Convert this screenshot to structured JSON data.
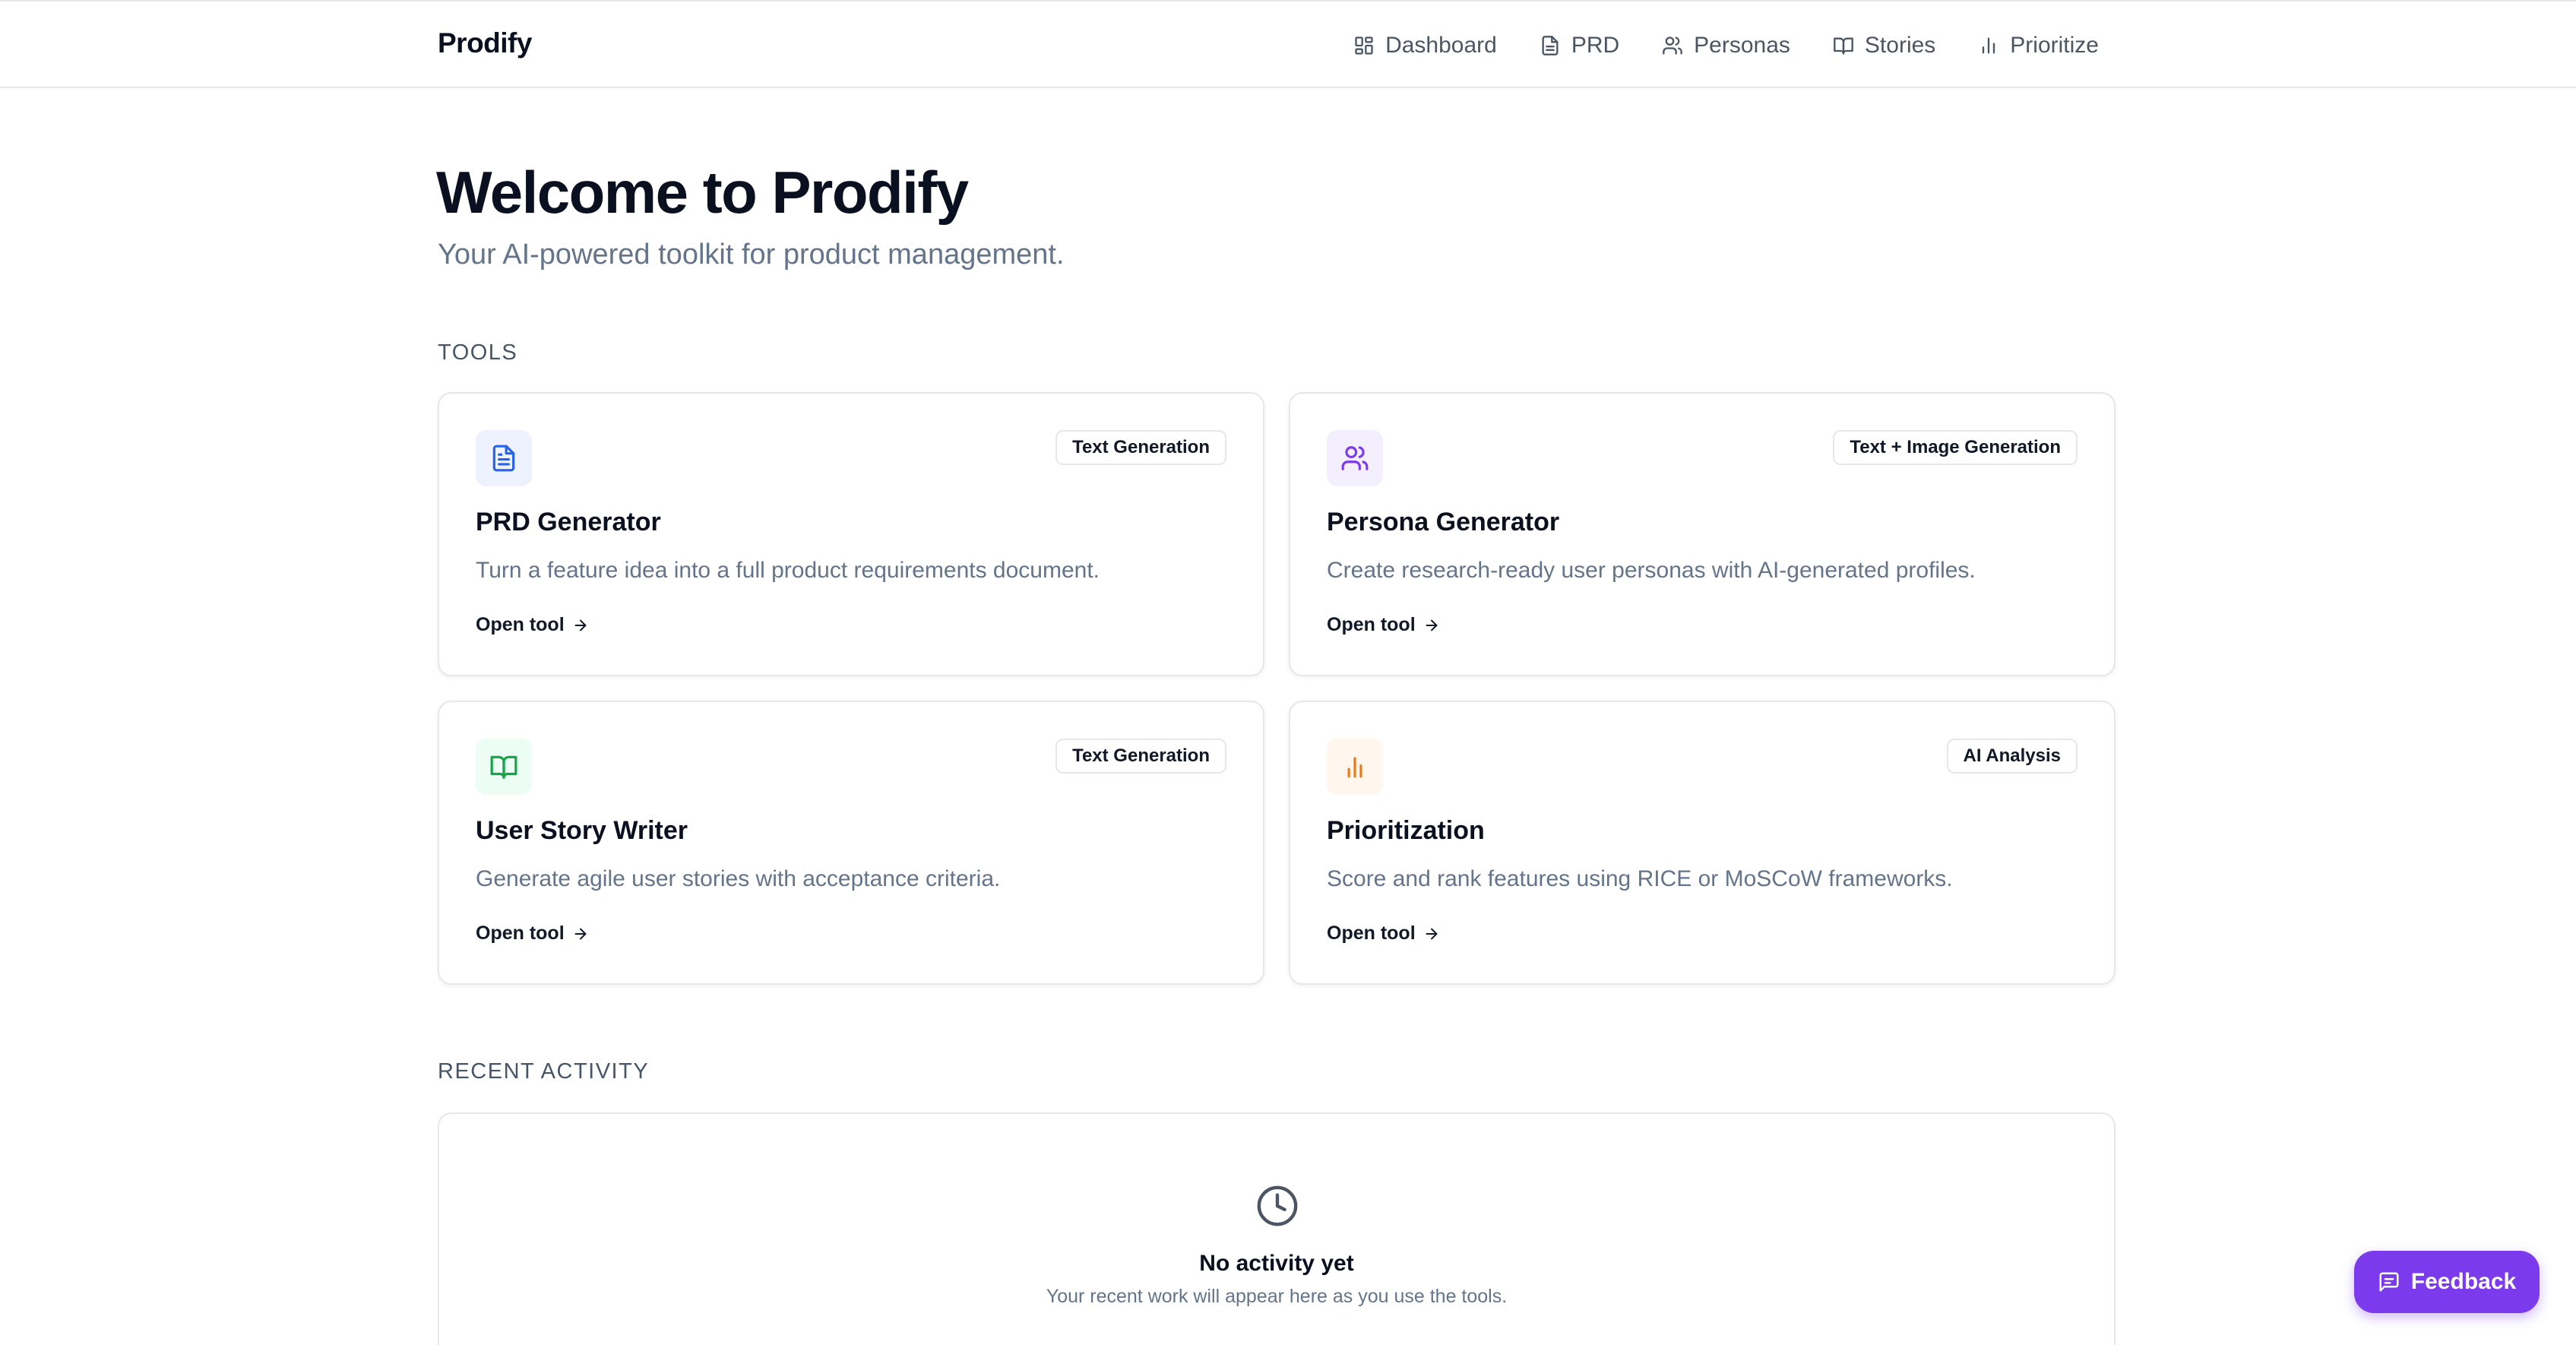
{
  "header": {
    "brand": "Prodify",
    "nav": [
      {
        "label": "Dashboard",
        "icon": "dashboard-icon"
      },
      {
        "label": "PRD",
        "icon": "document-icon"
      },
      {
        "label": "Personas",
        "icon": "users-icon"
      },
      {
        "label": "Stories",
        "icon": "book-icon"
      },
      {
        "label": "Prioritize",
        "icon": "bar-chart-icon"
      }
    ]
  },
  "hero": {
    "title": "Welcome to Prodify",
    "subtitle": "Your AI-powered toolkit for product management."
  },
  "tools": {
    "label": "TOOLS",
    "cards": [
      {
        "title": "PRD Generator",
        "badge": "Text Generation",
        "description": "Turn a feature idea into a full product requirements document.",
        "link": "Open tool",
        "icon": "document-icon",
        "accent": "#2563eb",
        "tint": "#eef2ff"
      },
      {
        "title": "Persona Generator",
        "badge": "Text + Image Generation",
        "description": "Create research-ready user personas with AI-generated profiles.",
        "link": "Open tool",
        "icon": "users-icon",
        "accent": "#7c3aed",
        "tint": "#f3efff"
      },
      {
        "title": "User Story Writer",
        "badge": "Text Generation",
        "description": "Generate agile user stories with acceptance criteria.",
        "link": "Open tool",
        "icon": "book-icon",
        "accent": "#16a34a",
        "tint": "#ecfdf3"
      },
      {
        "title": "Prioritization",
        "badge": "AI Analysis",
        "description": "Score and rank features using RICE or MoSCoW frameworks.",
        "link": "Open tool",
        "icon": "bar-chart-icon",
        "accent": "#ea7a17",
        "tint": "#fff6ed"
      }
    ]
  },
  "activity": {
    "label": "RECENT ACTIVITY",
    "empty_title": "No activity yet",
    "empty_subtitle": "Your recent work will appear here as you use the tools."
  },
  "feedback": {
    "label": "Feedback",
    "color": "#7c3aed"
  }
}
